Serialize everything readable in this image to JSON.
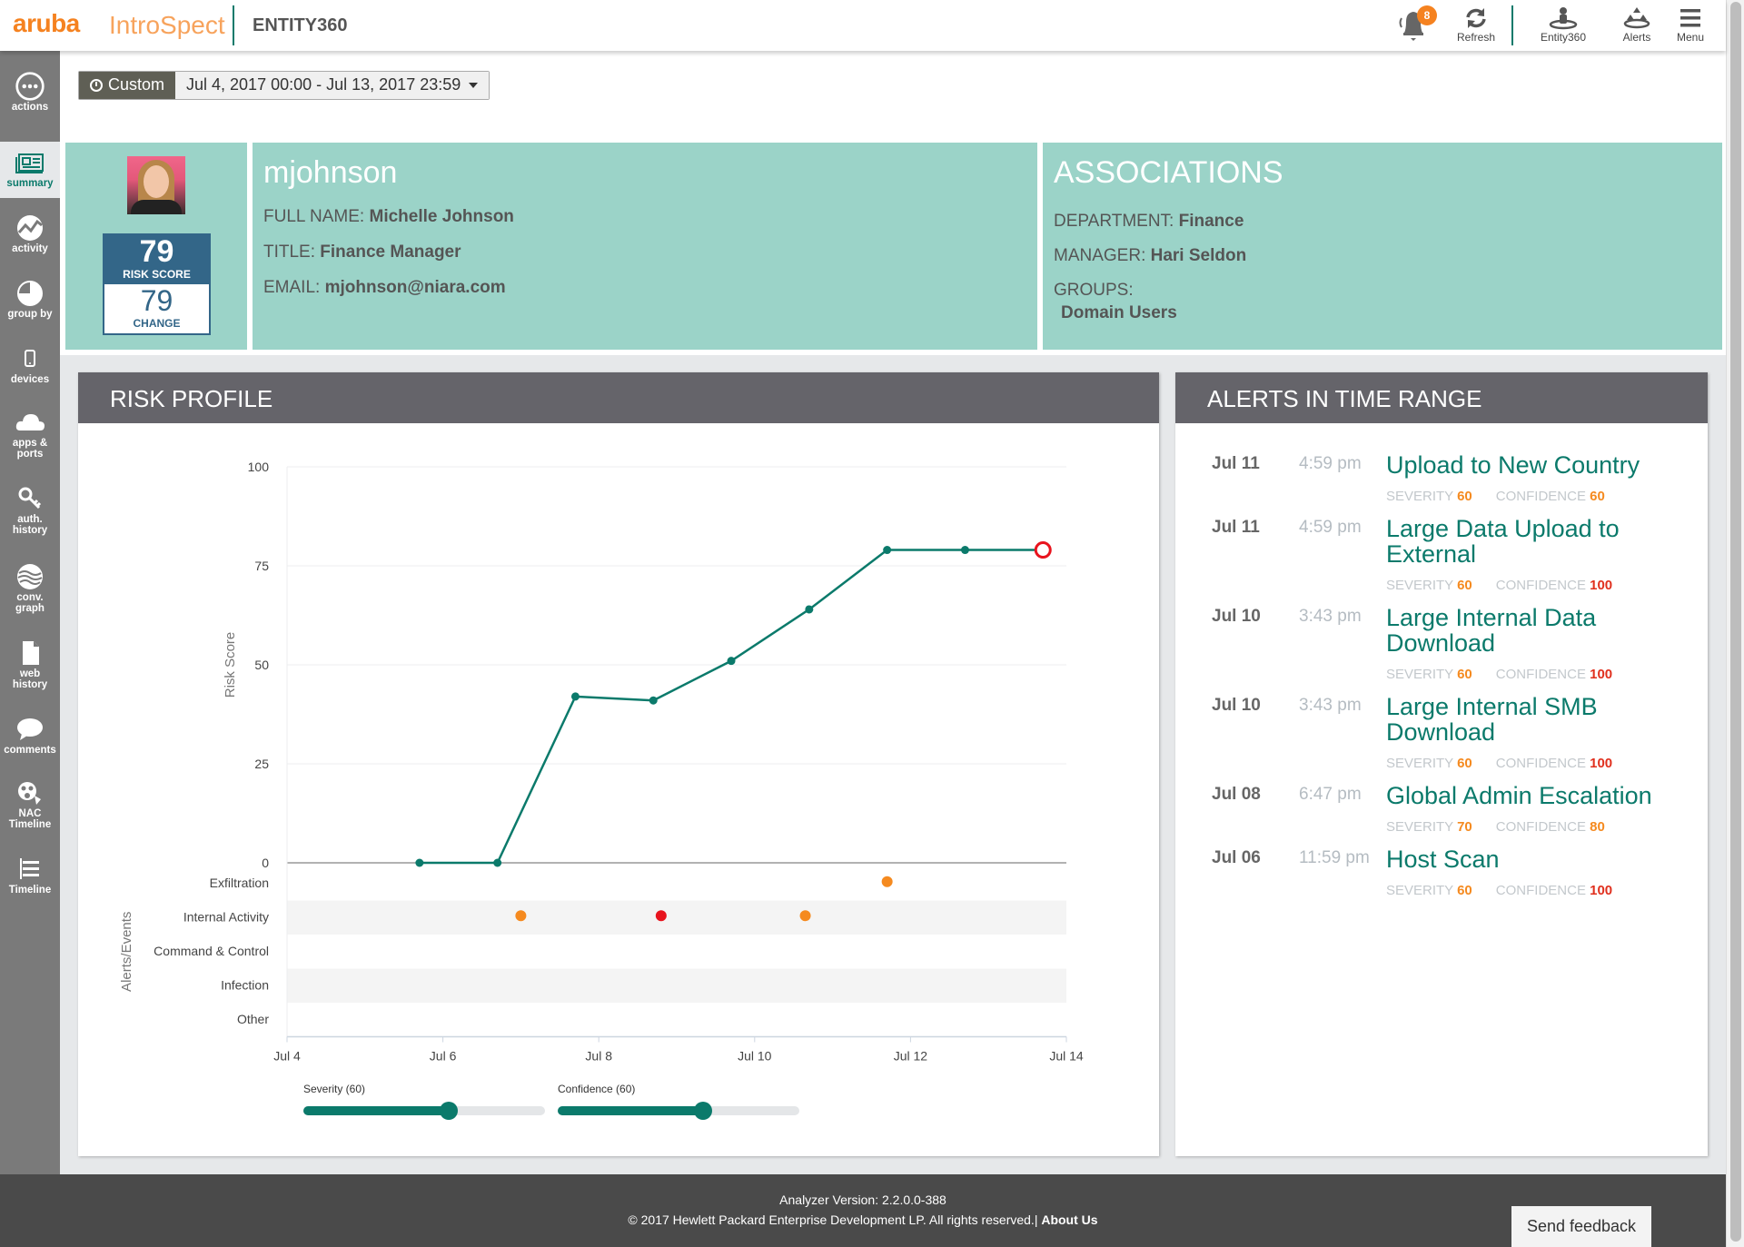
{
  "header": {
    "brand": "aruba",
    "product": "IntroSpect",
    "app_name": "ENTITY360",
    "notification_count": "8",
    "buttons": [
      {
        "label": "Refresh",
        "icon": "refresh-icon"
      },
      {
        "label": "Entity360",
        "icon": "entity360-icon"
      },
      {
        "label": "Alerts",
        "icon": "alerts-icon"
      },
      {
        "label": "Menu",
        "icon": "menu-icon"
      }
    ]
  },
  "sidebar": {
    "items": [
      {
        "label": "actions",
        "icon": "actions-icon"
      },
      {
        "label": "summary",
        "icon": "summary-icon",
        "active": true
      },
      {
        "label": "activity",
        "icon": "activity-icon"
      },
      {
        "label": "group by",
        "icon": "group-by-icon"
      },
      {
        "label": "devices",
        "icon": "devices-icon"
      },
      {
        "label": "apps &",
        "label2": "ports",
        "icon": "cloud-icon"
      },
      {
        "label": "auth.",
        "label2": "history",
        "icon": "key-icon"
      },
      {
        "label": "conv.",
        "label2": "graph",
        "icon": "conv-graph-icon"
      },
      {
        "label": "web",
        "label2": "history",
        "icon": "document-icon"
      },
      {
        "label": "comments",
        "icon": "comment-icon"
      },
      {
        "label": "NAC",
        "label2": "Timeline",
        "icon": "nac-icon"
      },
      {
        "label": "Timeline",
        "icon": "list-icon"
      }
    ]
  },
  "time_range": {
    "mode": "Custom",
    "range": "Jul 4, 2017 00:00 - Jul 13, 2017 23:59"
  },
  "profile": {
    "risk_score": "79",
    "risk_score_label": "RISK SCORE",
    "change": "79",
    "change_label": "CHANGE",
    "username": "mjohnson",
    "fields": [
      {
        "label": "FULL NAME: ",
        "value": "Michelle Johnson"
      },
      {
        "label": "TITLE: ",
        "value": "Finance Manager"
      },
      {
        "label": "EMAIL: ",
        "value": "mjohnson@niara.com"
      }
    ]
  },
  "associations": {
    "title": "ASSOCIATIONS",
    "department_label": "DEPARTMENT: ",
    "department": "Finance",
    "manager_label": "MANAGER: ",
    "manager": "Hari Seldon",
    "groups_label": "GROUPS:",
    "groups": "Domain Users"
  },
  "risk_panel": {
    "title": "RISK PROFILE",
    "severity_label": "Severity (60)",
    "severity_value": 60,
    "confidence_label": "Confidence (60)",
    "confidence_value": 60
  },
  "chart_data": {
    "type": "line",
    "title": "RISK PROFILE",
    "ylabel": "Risk Score",
    "ylabel_events": "Alerts/Events",
    "ylim": [
      0,
      100
    ],
    "yticks": [
      0,
      25,
      50,
      75,
      100
    ],
    "xlim_days": [
      4,
      14
    ],
    "xticks": [
      {
        "day": 4,
        "label": "Jul 4"
      },
      {
        "day": 6,
        "label": "Jul 6"
      },
      {
        "day": 8,
        "label": "Jul 8"
      },
      {
        "day": 10,
        "label": "Jul 10"
      },
      {
        "day": 12,
        "label": "Jul 12"
      },
      {
        "day": 14,
        "label": "Jul 14"
      }
    ],
    "grid": true,
    "series": [
      {
        "name": "Risk Score",
        "color": "#0b7a6b",
        "points": [
          {
            "day": 5.7,
            "value": 0
          },
          {
            "day": 6.7,
            "value": 0
          },
          {
            "day": 7.7,
            "value": 42
          },
          {
            "day": 8.7,
            "value": 41
          },
          {
            "day": 9.7,
            "value": 51
          },
          {
            "day": 10.7,
            "value": 64
          },
          {
            "day": 11.7,
            "value": 79
          },
          {
            "day": 12.7,
            "value": 79
          },
          {
            "day": 13.7,
            "value": 79
          }
        ],
        "current_point_color": "#e8141e"
      }
    ],
    "event_categories": [
      "Exfiltration",
      "Internal Activity",
      "Command & Control",
      "Infection",
      "Other"
    ],
    "events": [
      {
        "category": "Exfiltration",
        "day": 11.7,
        "color": "#f58a1f"
      },
      {
        "category": "Internal Activity",
        "day": 7.0,
        "color": "#f58a1f"
      },
      {
        "category": "Internal Activity",
        "day": 8.8,
        "color": "#e8141e"
      },
      {
        "category": "Internal Activity",
        "day": 10.65,
        "color": "#f58a1f"
      }
    ]
  },
  "alerts_panel": {
    "title": "ALERTS IN TIME RANGE",
    "severity_label": "SEVERITY",
    "confidence_label": "CONFIDENCE",
    "items": [
      {
        "date": "Jul 11",
        "time": "4:59 pm",
        "title": "Upload to New Country",
        "severity": "60",
        "severity_color": "#f58a1f",
        "confidence": "60",
        "confidence_color": "#f58a1f"
      },
      {
        "date": "Jul 11",
        "time": "4:59 pm",
        "title": "Large Data Upload to External",
        "severity": "60",
        "severity_color": "#f58a1f",
        "confidence": "100",
        "confidence_color": "#e0301e"
      },
      {
        "date": "Jul 10",
        "time": "3:43 pm",
        "title": "Large Internal Data Download",
        "severity": "60",
        "severity_color": "#f58a1f",
        "confidence": "100",
        "confidence_color": "#e0301e"
      },
      {
        "date": "Jul 10",
        "time": "3:43 pm",
        "title": "Large Internal SMB Download",
        "severity": "60",
        "severity_color": "#f58a1f",
        "confidence": "100",
        "confidence_color": "#e0301e"
      },
      {
        "date": "Jul 08",
        "time": "6:47 pm",
        "title": "Global Admin Escalation",
        "severity": "70",
        "severity_color": "#f58a1f",
        "confidence": "80",
        "confidence_color": "#f58a1f"
      },
      {
        "date": "Jul 06",
        "time": "11:59 pm",
        "title": "Host Scan",
        "severity": "60",
        "severity_color": "#f58a1f",
        "confidence": "100",
        "confidence_color": "#e0301e"
      }
    ]
  },
  "footer": {
    "version": "Analyzer Version: 2.2.0.0-388",
    "copyright": "© 2017 Hewlett Packard Enterprise Development LP. All rights reserved.| ",
    "about_link": "About Us",
    "feedback": "Send feedback"
  }
}
